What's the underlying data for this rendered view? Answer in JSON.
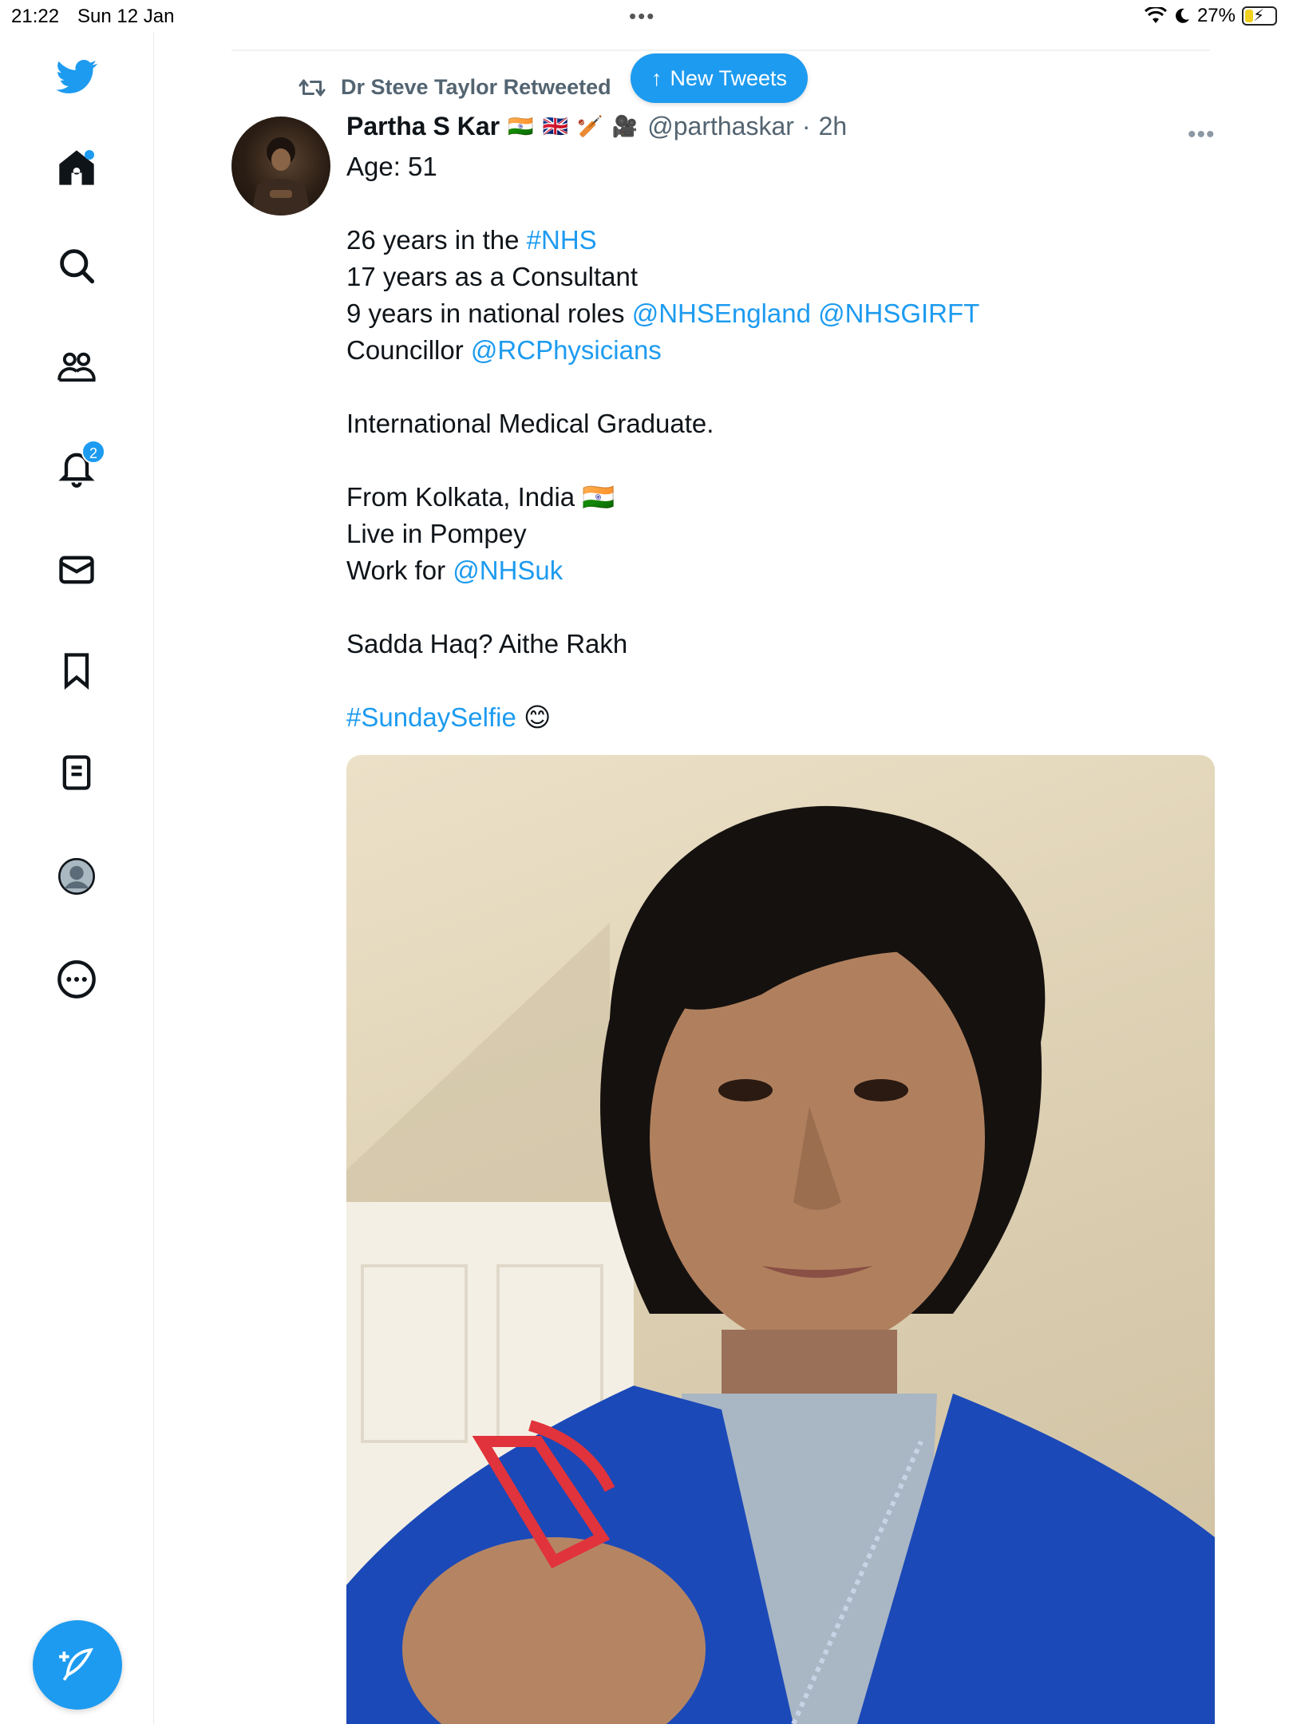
{
  "status_bar": {
    "time": "21:22",
    "date": "Sun 12 Jan",
    "battery": "27%"
  },
  "sidebar": {
    "items": [
      {
        "name": "home"
      },
      {
        "name": "explore"
      },
      {
        "name": "communities"
      },
      {
        "name": "notifications",
        "badge": "2"
      },
      {
        "name": "messages"
      },
      {
        "name": "bookmarks"
      },
      {
        "name": "lists"
      },
      {
        "name": "profile"
      },
      {
        "name": "more"
      }
    ]
  },
  "banner": {
    "new_tweets_label": "New Tweets"
  },
  "tweet": {
    "retweeted_by": "Dr Steve Taylor Retweeted",
    "author_name": "Partha S Kar",
    "author_emojis": "🇮🇳 🇬🇧 🏏 🎥",
    "handle": "@parthaskar",
    "separator": "·",
    "time_ago": "2h",
    "lines": {
      "l1": "Age: 51",
      "l2_text": "26 years in the ",
      "l2_link": "#NHS",
      "l3": "17 years as a Consultant",
      "l4_text": "9 years in national roles ",
      "l4_link1": "@NHSEngland",
      "l4_link2": "@NHSGIRFT",
      "l5_text": "Councillor ",
      "l5_link": "@RCPhysicians",
      "l6": "International Medical Graduate.",
      "l7": "From Kolkata, India 🇮🇳",
      "l8": "Live in Pompey",
      "l9_text": "Work for ",
      "l9_link": "@NHSuk",
      "l10": "Sadda Haq? Aithe Rakh",
      "l11_link": "#SundaySelfie",
      "l11_emoji": "😊"
    }
  },
  "colors": {
    "accent": "#1d9bf0",
    "text": "#0f1419",
    "muted": "#536471"
  }
}
